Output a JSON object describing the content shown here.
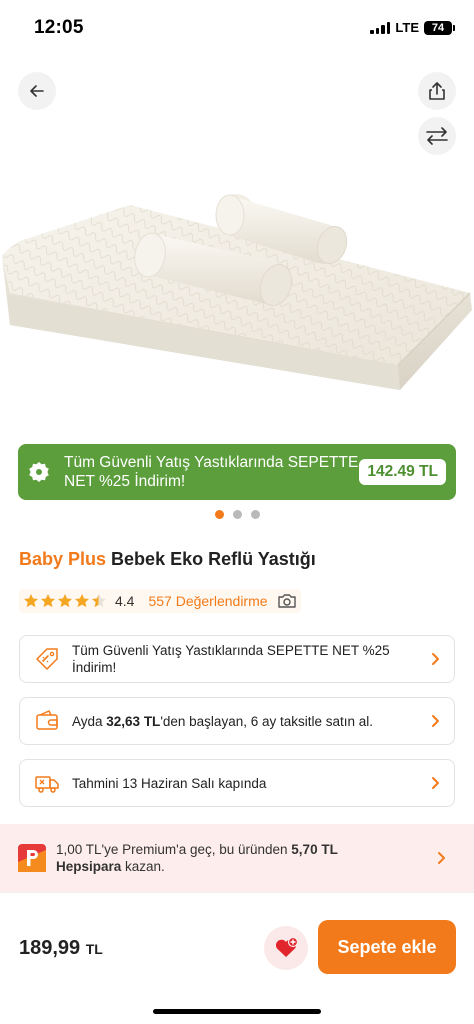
{
  "status": {
    "time": "12:05",
    "network": "LTE",
    "battery": "74"
  },
  "nav": {
    "back_icon": "arrow-left-icon",
    "share_icon": "share-icon",
    "compare_icon": "compare-arrows-icon"
  },
  "promo_banner": {
    "text": "Tüm Güvenli Yatış Yastıklarında SEPETTE NET %25 İndirim!",
    "price": "142.49 TL",
    "color": "#5c9e3c"
  },
  "carousel": {
    "count": 3,
    "active": 0
  },
  "product": {
    "brand": "Baby Plus",
    "name": "Bebek Eko Reflü Yastığı"
  },
  "rating": {
    "value": "4.4",
    "stars": 4.4,
    "reviews": "557 Değerlendirme"
  },
  "cards": [
    {
      "icon": "discount-tag-icon",
      "text": "Tüm Güvenli Yatış Yastıklarında SEPETTE NET %25 İndirim!"
    },
    {
      "icon": "wallet-icon",
      "prefix": "Ayda ",
      "bold": "32,63 TL",
      "suffix": "'den başlayan, 6 ay taksitle satın al."
    },
    {
      "icon": "delivery-truck-icon",
      "text": "Tahmini 13 Haziran Salı kapında"
    }
  ],
  "hepsipara": {
    "text1": "1,00 TL'ye Premium'a geç, bu üründen ",
    "bold1": "5,70 TL",
    "bold2": "Hepsipara",
    "text2": " kazan."
  },
  "bottom": {
    "price": "189,99",
    "currency": "TL",
    "cart_label": "Sepete ekle"
  },
  "colors": {
    "accent": "#f27a1a",
    "promo": "#5c9e3c",
    "favorite": "#e0252c"
  }
}
